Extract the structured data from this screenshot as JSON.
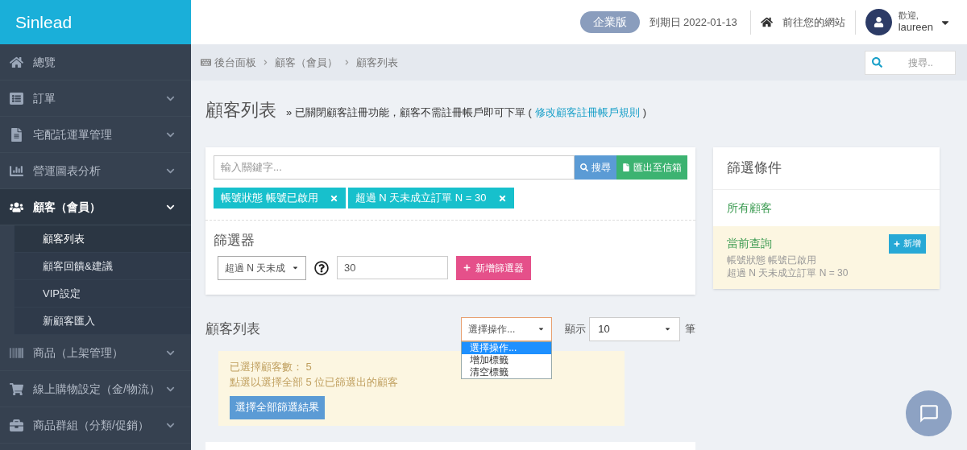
{
  "brand": "Sinlead",
  "sidebar": {
    "items": [
      {
        "label": "總覽",
        "selected": false
      },
      {
        "label": "訂單",
        "selected": false,
        "expanded": false
      },
      {
        "label": "宅配託運單管理",
        "selected": false,
        "expanded": false
      },
      {
        "label": "營運圖表分析",
        "selected": false,
        "expanded": false
      },
      {
        "label": "顧客（會員）",
        "selected": true,
        "expanded": true,
        "children": [
          {
            "label": "顧客列表",
            "selected": true
          },
          {
            "label": "顧客回饋&建議",
            "selected": false
          },
          {
            "label": "VIP設定",
            "selected": false
          },
          {
            "label": "新顧客匯入",
            "selected": false
          }
        ]
      },
      {
        "label": "商品（上架管理）",
        "selected": false,
        "expanded": false
      },
      {
        "label": "線上購物設定（金/物流）",
        "selected": false,
        "expanded": false
      },
      {
        "label": "商品群組（分類/促銷）",
        "selected": false,
        "expanded": false
      }
    ]
  },
  "topbar": {
    "plan": "企業版",
    "expiry": "到期日 2022-01-13",
    "site_link": "前往您的網站",
    "greeting": "歡迎,",
    "user": "laureen"
  },
  "breadcrumb": [
    "後台面板",
    "顧客（會員）",
    "顧客列表"
  ],
  "breadcrumb_search": {
    "placeholder": "搜尋.."
  },
  "page": {
    "title": "顧客列表",
    "note": "» 已關閉顧客註冊功能，顧客不需註冊帳戶即可下單 (",
    "note_link": "修改顧客註冊帳戶規則",
    "note_end": ")"
  },
  "search": {
    "placeholder": "輸入關鍵字...",
    "search_button": "搜尋",
    "export_button": "匯出至信箱"
  },
  "active_filters": [
    "帳號狀態 帳號已啟用",
    "超過 N 天未成立訂單 N = 30"
  ],
  "filter_builder": {
    "title": "篩選器",
    "select_value": "超過 N 天未成",
    "input_value": "30",
    "add_button": "新增篩選器"
  },
  "conditions": {
    "title": "篩選條件",
    "all": "所有顧客",
    "current_title": "當前查詢",
    "add_button": "新增",
    "current_lines": [
      "帳號狀態 帳號已啟用",
      "超過 N 天未成立訂單 N = 30"
    ]
  },
  "list": {
    "title": "顧客列表",
    "action_select": {
      "value": "選擇操作...",
      "open": true,
      "options": [
        {
          "label": "選擇操作...",
          "selected": true
        },
        {
          "label": "增加標籤",
          "selected": false
        },
        {
          "label": "清空標籤",
          "selected": false
        }
      ]
    },
    "show_label": "顯示",
    "per_page": "10",
    "unit": "筆"
  },
  "selection": {
    "count_text": "已選擇顧客數： 5",
    "hint": "點選以選擇全部 5 位已篩選出的顧客",
    "button": "選擇全部篩選結果"
  }
}
